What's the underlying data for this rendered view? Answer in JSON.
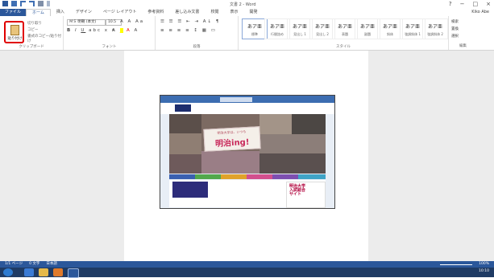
{
  "window": {
    "title": "文書 2 - Word",
    "controls": [
      "?",
      "−",
      "□",
      "×"
    ],
    "user": "Kiko Abe"
  },
  "tabs": [
    "ファイル",
    "ホーム",
    "挿入",
    "デザイン",
    "ページ レイアウト",
    "参考資料",
    "差し込み文書",
    "校閲",
    "表示",
    "開発"
  ],
  "clipboard": {
    "paste_label": "貼り付け",
    "cut": "切り取り",
    "copy": "コピー",
    "format_painter": "書式のコピー/貼り付け",
    "group_label": "クリップボード"
  },
  "font": {
    "name": "ＭＳ 明朝 (本文)",
    "size": "10.5",
    "group_label": "フォント"
  },
  "paragraph": {
    "group_label": "段落"
  },
  "styles": {
    "items": [
      {
        "sample": "あア亜",
        "name": "標準"
      },
      {
        "sample": "あア亜",
        "name": "行間詰め"
      },
      {
        "sample": "あア亜",
        "name": "見出し 1"
      },
      {
        "sample": "あア亜",
        "name": "見出し 2"
      },
      {
        "sample": "あア亜",
        "name": "表題"
      },
      {
        "sample": "あア亜",
        "name": "副題"
      },
      {
        "sample": "あア亜",
        "name": "斜体"
      },
      {
        "sample": "あア亜",
        "name": "強調斜体 1"
      },
      {
        "sample": "あア亜",
        "name": "強調斜体 2"
      }
    ],
    "group_label": "スタイル"
  },
  "editing": {
    "find": "検索",
    "replace": "置換",
    "select": "選択",
    "group_label": "編集"
  },
  "image_content": {
    "banner_small": "明治大学は、いつも",
    "banner_big": "明治ing!",
    "ad_text": "明治大学 入試総合 サイト"
  },
  "status": {
    "page": "1/1 ページ",
    "words": "0 文字",
    "language": "日本語",
    "zoom": "100%"
  },
  "taskbar": {
    "clock": "10:10"
  }
}
